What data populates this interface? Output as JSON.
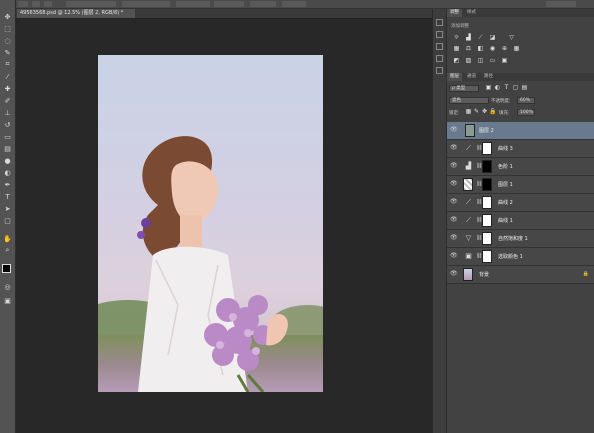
{
  "document": {
    "tab_title": "49563568.psd @ 12.5% (图层 2, RGB/8) *"
  },
  "tools": [
    "move-icon",
    "marquee-icon",
    "lasso-icon",
    "quick-select-icon",
    "crop-icon",
    "eyedropper-icon",
    "healing-icon",
    "brush-icon",
    "stamp-icon",
    "history-brush-icon",
    "eraser-icon",
    "gradient-icon",
    "blur-icon",
    "dodge-icon",
    "pen-icon",
    "type-icon",
    "path-select-icon",
    "shape-icon",
    "hand-icon",
    "zoom-icon"
  ],
  "adjustments_panel": {
    "tabs": [
      "调整",
      "样式"
    ],
    "title": "添加调整"
  },
  "layers_panel": {
    "tabs": [
      "图层",
      "通道",
      "路径"
    ],
    "filter_kind": "ρ 类型",
    "blend_mode": "滤色",
    "opacity_label": "不透明度:",
    "opacity_value": "60%",
    "lock_label": "锁定:",
    "fill_label": "填充:",
    "fill_value": "100%",
    "layers": [
      {
        "name": "图层 2",
        "kind": "pixel",
        "selected": true
      },
      {
        "name": "曲线 3",
        "kind": "curves",
        "selected": false
      },
      {
        "name": "色阶 1",
        "kind": "levels",
        "selected": false
      },
      {
        "name": "图层 1",
        "kind": "pixel-masked",
        "selected": false
      },
      {
        "name": "曲线 2",
        "kind": "curves",
        "selected": false
      },
      {
        "name": "曲线 1",
        "kind": "curves",
        "selected": false
      },
      {
        "name": "自然饱和度 1",
        "kind": "vibrance",
        "selected": false
      },
      {
        "name": "选取颜色 1",
        "kind": "selective-color",
        "selected": false
      },
      {
        "name": "背景",
        "kind": "background",
        "selected": false
      }
    ]
  },
  "colors": {
    "selected_layer": "#6a7a8e",
    "panel_bg": "#424242",
    "canvas_bg": "#282828"
  }
}
